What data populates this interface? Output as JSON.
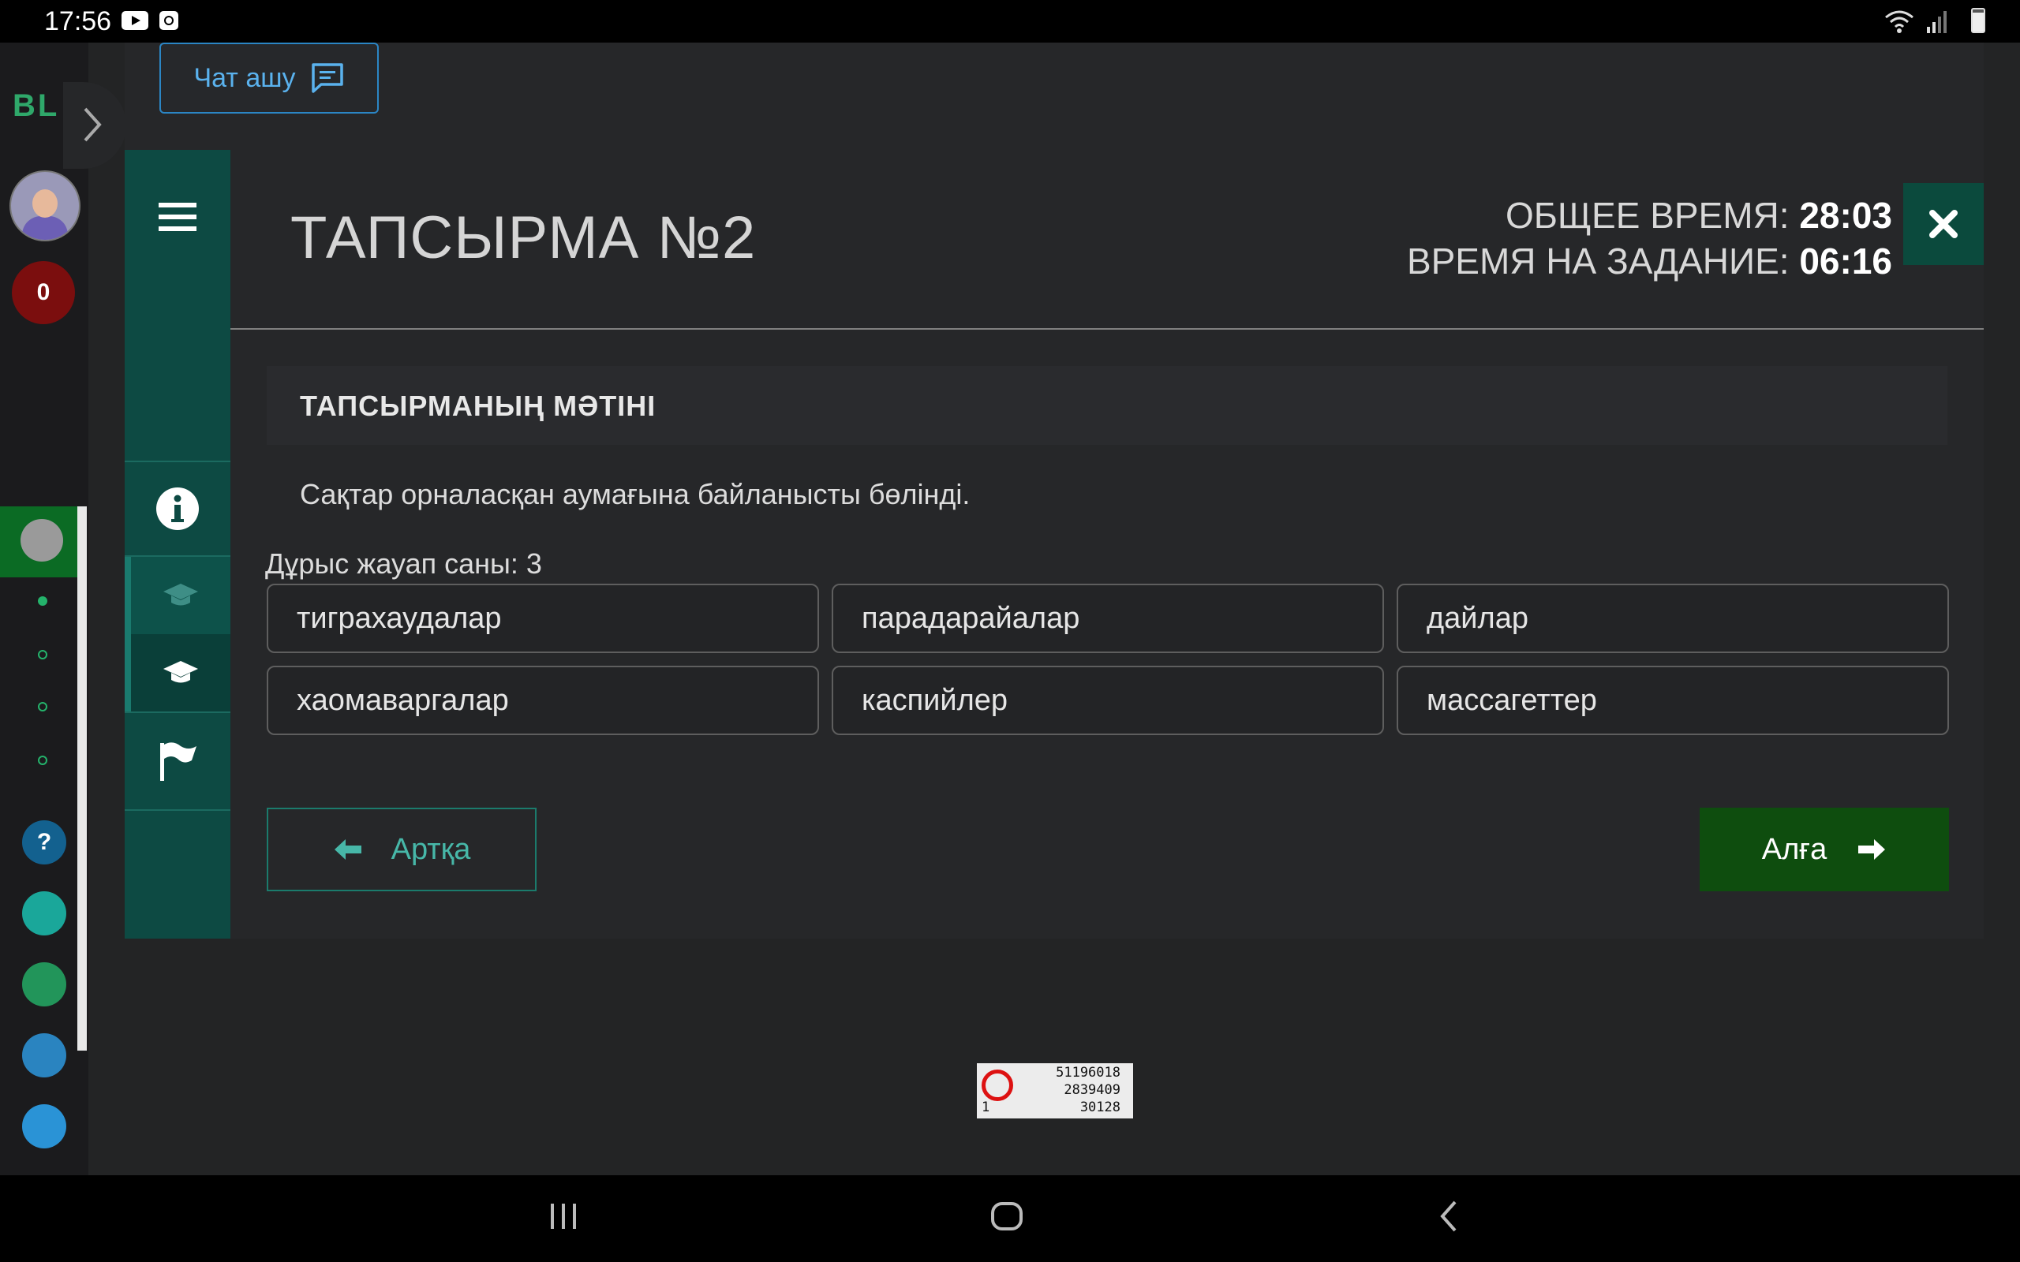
{
  "status_bar": {
    "time": "17:56"
  },
  "sidebar": {
    "logo": "BL",
    "notification_count": "0",
    "help_label": "?"
  },
  "chat": {
    "label": "Чат ашу"
  },
  "task": {
    "title": "ТАПСЫРМА №2",
    "heading": "ТАПСЫРМАНЫҢ МӘТІНІ",
    "text": "Сақтар орналасқан аумағына байланысты бөлінді.",
    "answer_count": "Дұрыс жауап саны: 3"
  },
  "timer": {
    "total_label": "ОБЩЕЕ ВРЕМЯ:",
    "total_value": "28:03",
    "task_label": "ВРЕМЯ НА ЗАДАНИЕ:",
    "task_value": "06:16"
  },
  "options": [
    {
      "label": "тиграхаудалар"
    },
    {
      "label": "парадарайалар"
    },
    {
      "label": "дайлар"
    },
    {
      "label": "хаомаваргалар"
    },
    {
      "label": "каспийлер"
    },
    {
      "label": "массагеттер"
    }
  ],
  "navigation": {
    "back_label": "Артқа",
    "next_label": "Алға"
  },
  "stamp": {
    "line1": "51196018",
    "line2": "2839409",
    "line3": "30128",
    "line4": "1"
  },
  "colors": {
    "accent_green": "#0e4d0e",
    "sidenav_teal": "#0d4a43",
    "chat_blue": "#2b86c5",
    "badge_red": "#7b0e0e"
  }
}
